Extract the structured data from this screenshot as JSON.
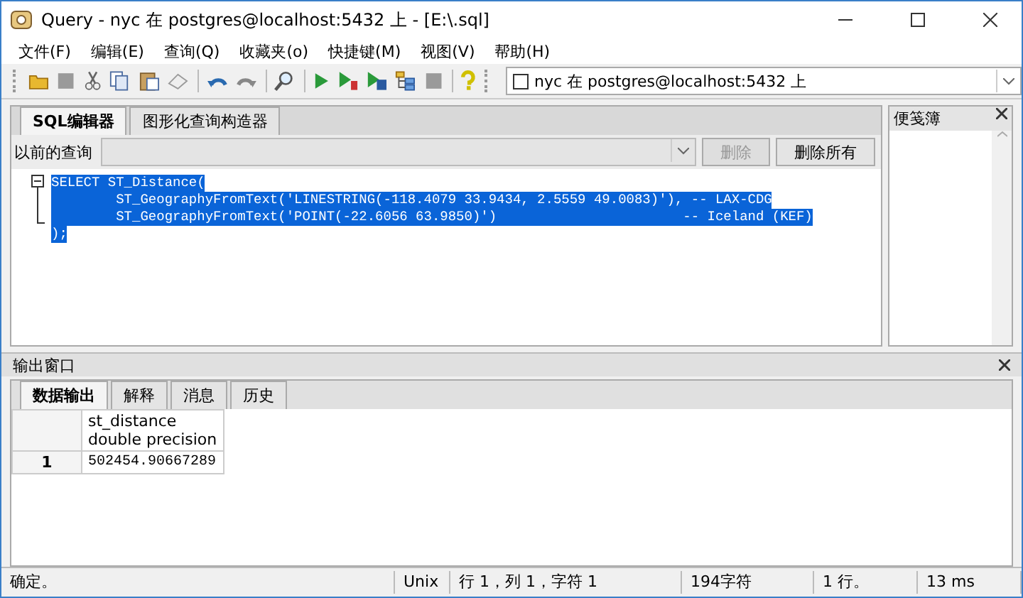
{
  "window": {
    "title": "Query - nyc 在  postgres@localhost:5432 上 - [E:\\.sql]"
  },
  "menu": [
    "文件(F)",
    "编辑(E)",
    "查询(Q)",
    "收藏夹(o)",
    "快捷键(M)",
    "视图(V)",
    "帮助(H)"
  ],
  "connection": {
    "value": "nyc 在  postgres@localhost:5432 上"
  },
  "editor_tabs": [
    {
      "label": "SQL编辑器",
      "selected": true
    },
    {
      "label": "图形化查询构造器",
      "selected": false
    }
  ],
  "previous_queries": {
    "label": "以前的查询",
    "delete": {
      "label": "删除",
      "disabled": true
    },
    "delete_all": {
      "label": "删除所有",
      "disabled": false
    }
  },
  "code_lines": [
    "SELECT ST_Distance(",
    "        ST_GeographyFromText('LINESTRING(-118.4079 33.9434, 2.5559 49.0083)'), -- LAX-CDG",
    "        ST_GeographyFromText('POINT(-22.6056 63.9850)')                       -- Iceland (KEF)",
    ");"
  ],
  "scratch_pad": {
    "title": "便笺簿"
  },
  "output": {
    "title": "输出窗口",
    "tabs": [
      {
        "label": "数据输出",
        "selected": true
      },
      {
        "label": "解释",
        "selected": false
      },
      {
        "label": "消息",
        "selected": false
      },
      {
        "label": "历史",
        "selected": false
      }
    ],
    "columns": [
      {
        "name": "st_distance",
        "type": "double precision"
      }
    ],
    "rows": [
      {
        "number": "1",
        "cells": [
          "502454.90667289"
        ]
      }
    ]
  },
  "status_bar": [
    "确定。",
    "Unix",
    "行 1，列 1，字符 1",
    "194字符",
    "1 行。",
    "13 ms"
  ]
}
